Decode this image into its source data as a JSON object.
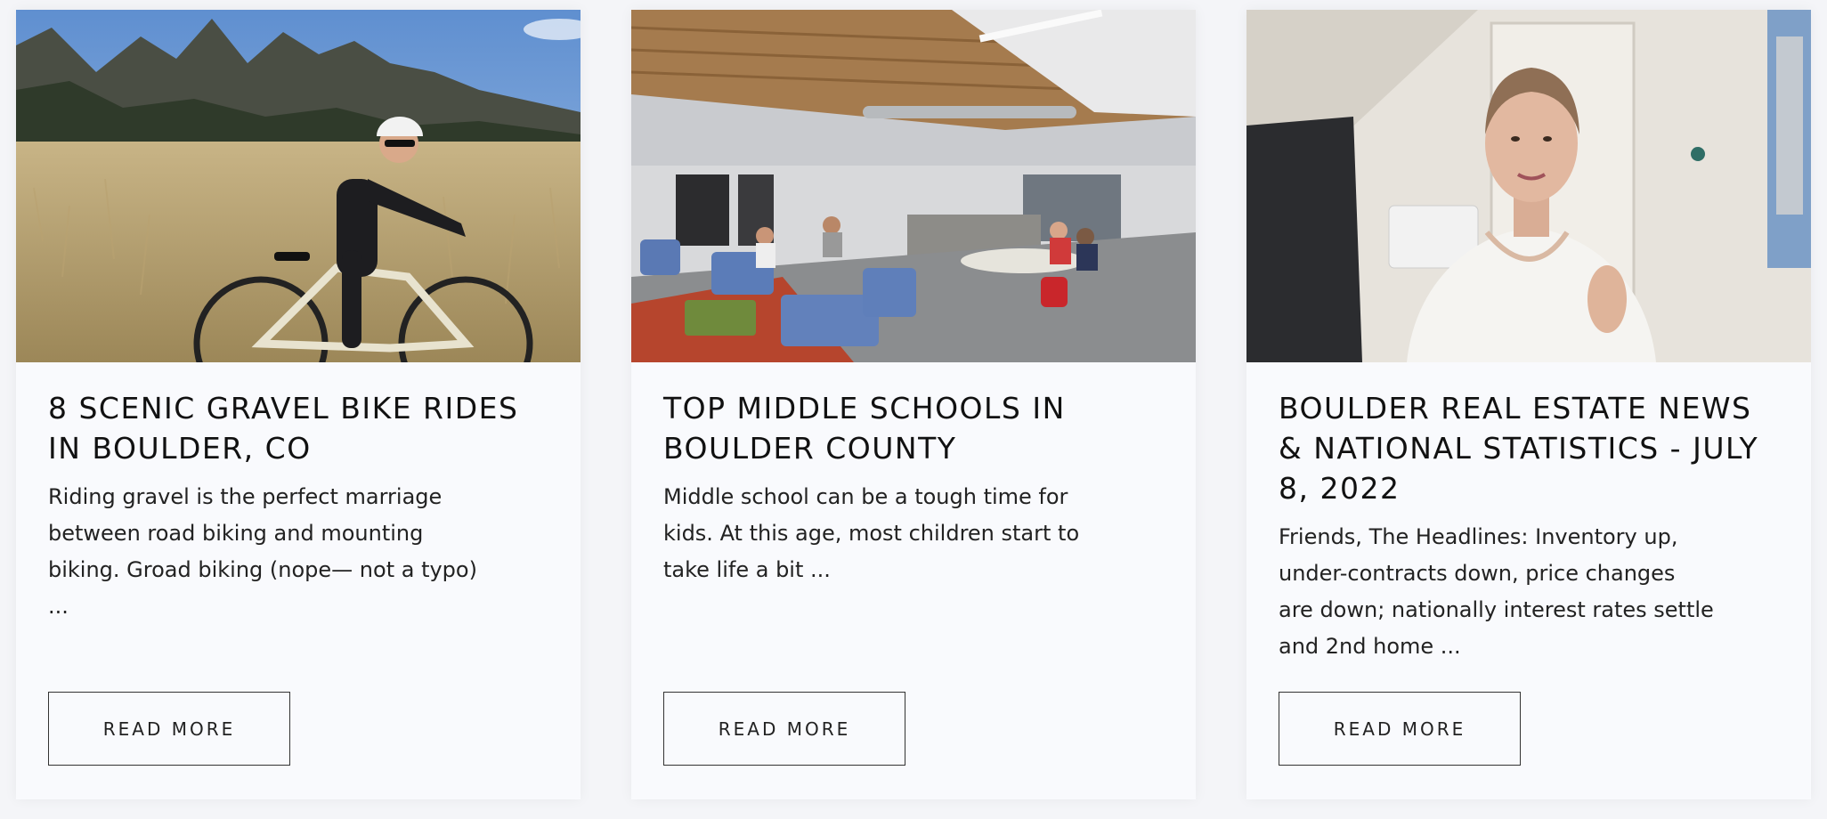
{
  "cards": [
    {
      "title": "8 SCENIC GRAVEL BIKE RIDES\nIN BOULDER, CO",
      "excerpt": "   Riding gravel is the perfect marriage\nbetween road biking and mounting\nbiking. Groad biking (nope— not a typo)\n...",
      "button_label": "READ MORE",
      "image_subject": "cyclist-in-meadow"
    },
    {
      "title": "TOP MIDDLE SCHOOLS IN\nBOULDER COUNTY",
      "excerpt": "Middle school can be a tough time for\nkids. At this age, most children start to\ntake life a bit ...",
      "button_label": "READ MORE",
      "image_subject": "school-commons-interior"
    },
    {
      "title": "BOULDER REAL ESTATE NEWS\n& NATIONAL STATISTICS - JULY\n8, 2022",
      "excerpt": "  Friends,   The Headlines: Inventory up,\nunder-contracts down, price changes\nare down; nationally interest rates settle\nand 2nd home ...",
      "button_label": "READ MORE",
      "image_subject": "woman-speaking-to-camera"
    }
  ]
}
